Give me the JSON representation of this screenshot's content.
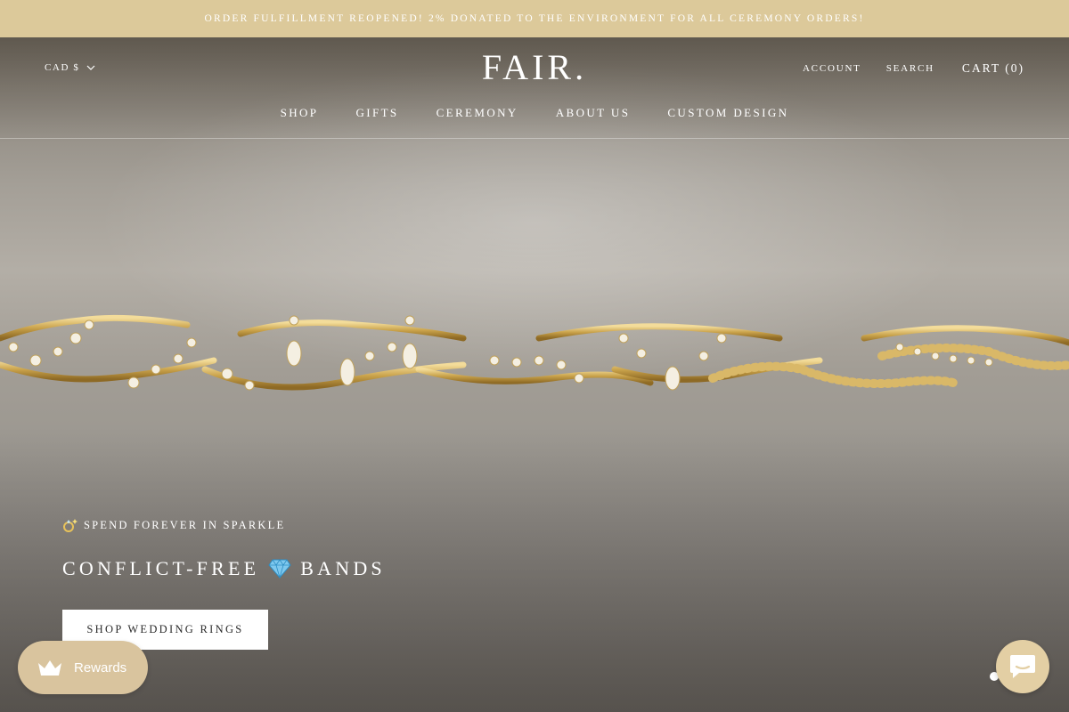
{
  "announcement": {
    "text": "ORDER FULFILLMENT REOPENED! 2% DONATED TO THE ENVIRONMENT FOR ALL CEREMONY ORDERS!"
  },
  "header": {
    "currency_label": "CAD $",
    "logo_text": "FAIR.",
    "account_label": "ACCOUNT",
    "search_label": "SEARCH",
    "cart_label": "CART (0)"
  },
  "nav": {
    "items": [
      {
        "label": "SHOP"
      },
      {
        "label": "GIFTS"
      },
      {
        "label": "CEREMONY"
      },
      {
        "label": "ABOUT US"
      },
      {
        "label": "CUSTOM DESIGN"
      }
    ]
  },
  "hero": {
    "eyebrow_emoji_icon": "sparkle-ring-icon",
    "eyebrow_text": "SPEND FOREVER IN SPARKLE",
    "headline_before": "CONFLICT-FREE",
    "headline_icon": "gem-stone-icon",
    "headline_after": "BANDS",
    "cta_label": "SHOP WEDDING RINGS",
    "slide_count": 1,
    "active_slide": 1
  },
  "rewards": {
    "icon": "crown-icon",
    "label": "Rewards"
  },
  "chat": {
    "icon": "chat-bubble-icon"
  },
  "colors": {
    "announcement_bg": "#dcc99a",
    "rewards_bg": "#d9c49e",
    "chat_bg": "#e3cfa4",
    "cta_bg": "#ffffff",
    "cta_text": "#2c2c2c",
    "ring_gold": "#c9a24a"
  }
}
